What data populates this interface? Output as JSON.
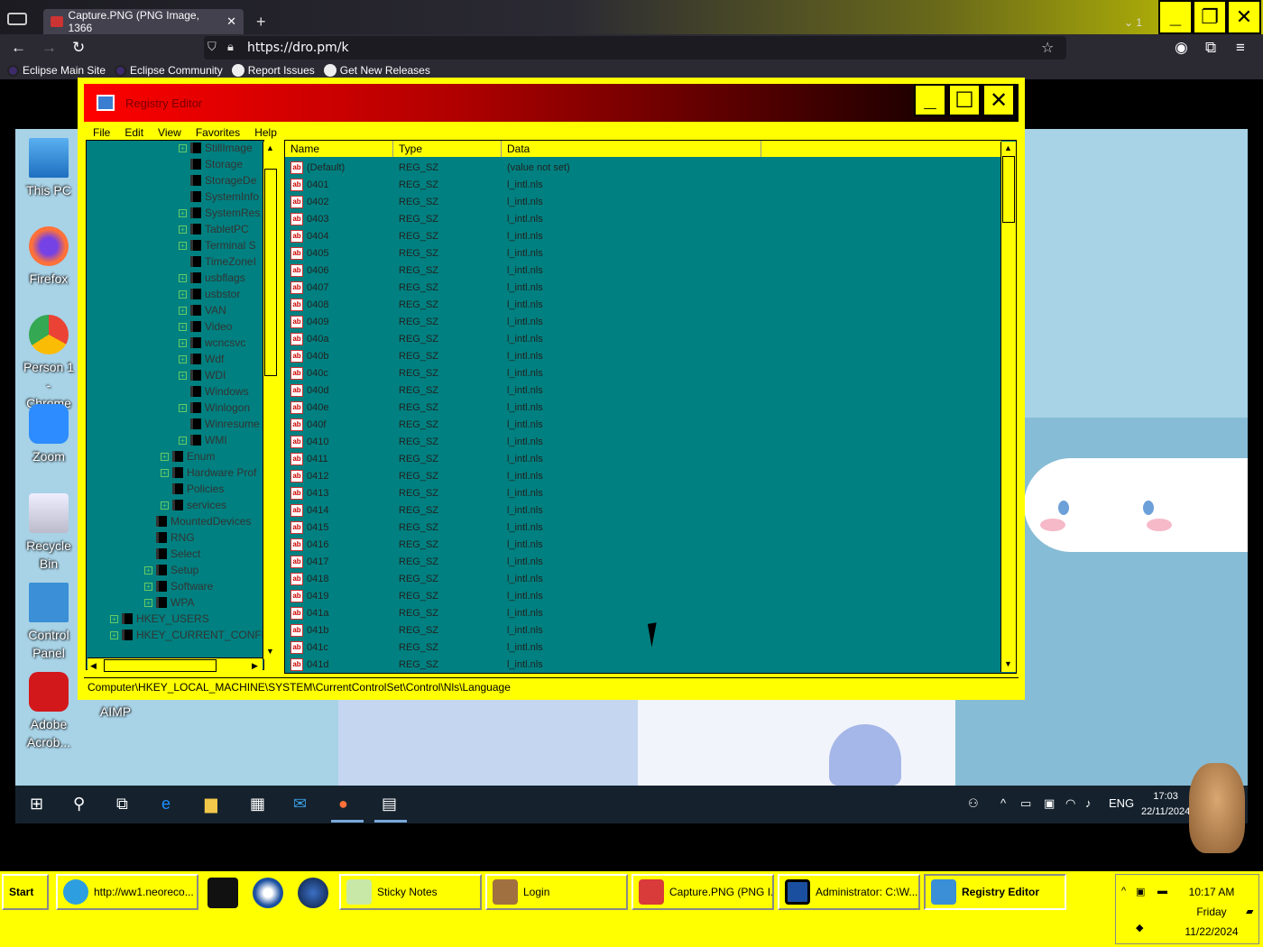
{
  "browser": {
    "tab_title": "Capture.PNG (PNG Image, 1366",
    "tab_count": "1",
    "url": "https://dro.pm/k",
    "bookmarks": [
      "Eclipse Main Site",
      "Eclipse Community",
      "Report Issues",
      "Get New Releases"
    ]
  },
  "desktop": {
    "icons": [
      "This PC",
      "Firefox",
      "Person 1 - Chrome",
      "Zoom",
      "Recycle Bin",
      "Control Panel",
      "Adobe Acrob...",
      "AIMP"
    ]
  },
  "regedit": {
    "title": "Registry Editor",
    "menu": [
      "File",
      "Edit",
      "View",
      "Favorites",
      "Help"
    ],
    "tree": [
      {
        "label": "StillImage",
        "level": 5,
        "exp": true
      },
      {
        "label": "Storage",
        "level": 5,
        "exp": false
      },
      {
        "label": "StorageDe",
        "level": 5,
        "exp": false
      },
      {
        "label": "SystemInfo",
        "level": 5,
        "exp": false
      },
      {
        "label": "SystemRes",
        "level": 5,
        "exp": true
      },
      {
        "label": "TabletPC",
        "level": 5,
        "exp": true
      },
      {
        "label": "Terminal S",
        "level": 5,
        "exp": true
      },
      {
        "label": "TimeZoneI",
        "level": 5,
        "exp": false
      },
      {
        "label": "usbflags",
        "level": 5,
        "exp": true
      },
      {
        "label": "usbstor",
        "level": 5,
        "exp": true
      },
      {
        "label": "VAN",
        "level": 5,
        "exp": true
      },
      {
        "label": "Video",
        "level": 5,
        "exp": true
      },
      {
        "label": "wcncsvc",
        "level": 5,
        "exp": true
      },
      {
        "label": "Wdf",
        "level": 5,
        "exp": true
      },
      {
        "label": "WDI",
        "level": 5,
        "exp": true
      },
      {
        "label": "Windows",
        "level": 5,
        "exp": false
      },
      {
        "label": "Winlogon",
        "level": 5,
        "exp": true
      },
      {
        "label": "Winresume",
        "level": 5,
        "exp": false
      },
      {
        "label": "WMI",
        "level": 5,
        "exp": true
      },
      {
        "label": "Enum",
        "level": 4,
        "exp": true
      },
      {
        "label": "Hardware Prof",
        "level": 4,
        "exp": true
      },
      {
        "label": "Policies",
        "level": 4,
        "exp": false
      },
      {
        "label": "services",
        "level": 4,
        "exp": true
      },
      {
        "label": "MountedDevices",
        "level": 3,
        "exp": false
      },
      {
        "label": "RNG",
        "level": 3,
        "exp": false
      },
      {
        "label": "Select",
        "level": 3,
        "exp": false
      },
      {
        "label": "Setup",
        "level": 3,
        "exp": true
      },
      {
        "label": "Software",
        "level": 3,
        "exp": true
      },
      {
        "label": "WPA",
        "level": 3,
        "exp": true
      },
      {
        "label": "HKEY_USERS",
        "level": 1,
        "exp": true
      },
      {
        "label": "HKEY_CURRENT_CONFIG",
        "level": 1,
        "exp": true
      }
    ],
    "columns": [
      "Name",
      "Type",
      "Data"
    ],
    "rows": [
      [
        "(Default)",
        "REG_SZ",
        "(value not set)"
      ],
      [
        "0401",
        "REG_SZ",
        "l_intl.nls"
      ],
      [
        "0402",
        "REG_SZ",
        "l_intl.nls"
      ],
      [
        "0403",
        "REG_SZ",
        "l_intl.nls"
      ],
      [
        "0404",
        "REG_SZ",
        "l_intl.nls"
      ],
      [
        "0405",
        "REG_SZ",
        "l_intl.nls"
      ],
      [
        "0406",
        "REG_SZ",
        "l_intl.nls"
      ],
      [
        "0407",
        "REG_SZ",
        "l_intl.nls"
      ],
      [
        "0408",
        "REG_SZ",
        "l_intl.nls"
      ],
      [
        "0409",
        "REG_SZ",
        "l_intl.nls"
      ],
      [
        "040a",
        "REG_SZ",
        "l_intl.nls"
      ],
      [
        "040b",
        "REG_SZ",
        "l_intl.nls"
      ],
      [
        "040c",
        "REG_SZ",
        "l_intl.nls"
      ],
      [
        "040d",
        "REG_SZ",
        "l_intl.nls"
      ],
      [
        "040e",
        "REG_SZ",
        "l_intl.nls"
      ],
      [
        "040f",
        "REG_SZ",
        "l_intl.nls"
      ],
      [
        "0410",
        "REG_SZ",
        "l_intl.nls"
      ],
      [
        "0411",
        "REG_SZ",
        "l_intl.nls"
      ],
      [
        "0412",
        "REG_SZ",
        "l_intl.nls"
      ],
      [
        "0413",
        "REG_SZ",
        "l_intl.nls"
      ],
      [
        "0414",
        "REG_SZ",
        "l_intl.nls"
      ],
      [
        "0415",
        "REG_SZ",
        "l_intl.nls"
      ],
      [
        "0416",
        "REG_SZ",
        "l_intl.nls"
      ],
      [
        "0417",
        "REG_SZ",
        "l_intl.nls"
      ],
      [
        "0418",
        "REG_SZ",
        "l_intl.nls"
      ],
      [
        "0419",
        "REG_SZ",
        "l_intl.nls"
      ],
      [
        "041a",
        "REG_SZ",
        "l_intl.nls"
      ],
      [
        "041b",
        "REG_SZ",
        "l_intl.nls"
      ],
      [
        "041c",
        "REG_SZ",
        "l_intl.nls"
      ],
      [
        "041d",
        "REG_SZ",
        "l_intl.nls"
      ]
    ],
    "status_path": "Computer\\HKEY_LOCAL_MACHINE\\SYSTEM\\CurrentControlSet\\Control\\Nls\\Language"
  },
  "remote_taskbar": {
    "lang": "ENG",
    "time": "17:03",
    "date": "22/11/2024"
  },
  "host_taskbar": {
    "start": "Start",
    "items": [
      "http://ww1.neoreco...",
      "Sticky Notes",
      "Login",
      "Capture.PNG (PNG I...",
      "Administrator: C:\\W...",
      "Registry Editor"
    ],
    "time": "10:17 AM",
    "day": "Friday",
    "date": "11/22/2024"
  }
}
